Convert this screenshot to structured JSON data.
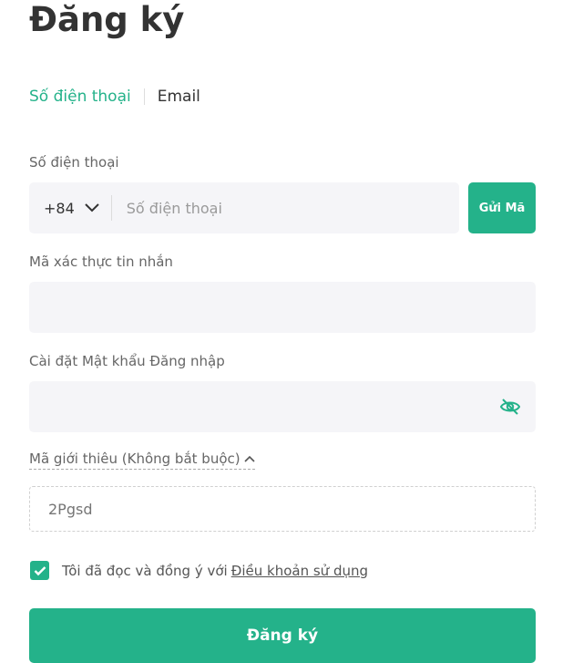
{
  "page": {
    "title": "Đăng ký"
  },
  "tabs": {
    "phone": "Số điện thoại",
    "email": "Email",
    "active": "phone"
  },
  "phone": {
    "label": "Số điện thoại",
    "country_code": "+84",
    "placeholder": "Số điện thoại",
    "value": "",
    "send_code_label": "Gửi Mã"
  },
  "sms_code": {
    "label": "Mã xác thực tin nhắn",
    "value": ""
  },
  "password": {
    "label": "Cài đặt Mật khẩu Đăng nhập",
    "value": "",
    "visibility_icon": "eye-slash-icon"
  },
  "referral": {
    "toggle_label": "Mã giới thiêu (Không bắt buộc)",
    "expanded": true,
    "placeholder": "2Pgsd",
    "value": ""
  },
  "agreement": {
    "checked": true,
    "text": "Tôi đã đọc và đồng ý với",
    "link_text": "Điều khoản sử dụng"
  },
  "submit_label": "Đăng ký",
  "colors": {
    "accent": "#24b28a",
    "input_bg": "#f5f5f8",
    "title": "#333333",
    "label": "#666666"
  }
}
